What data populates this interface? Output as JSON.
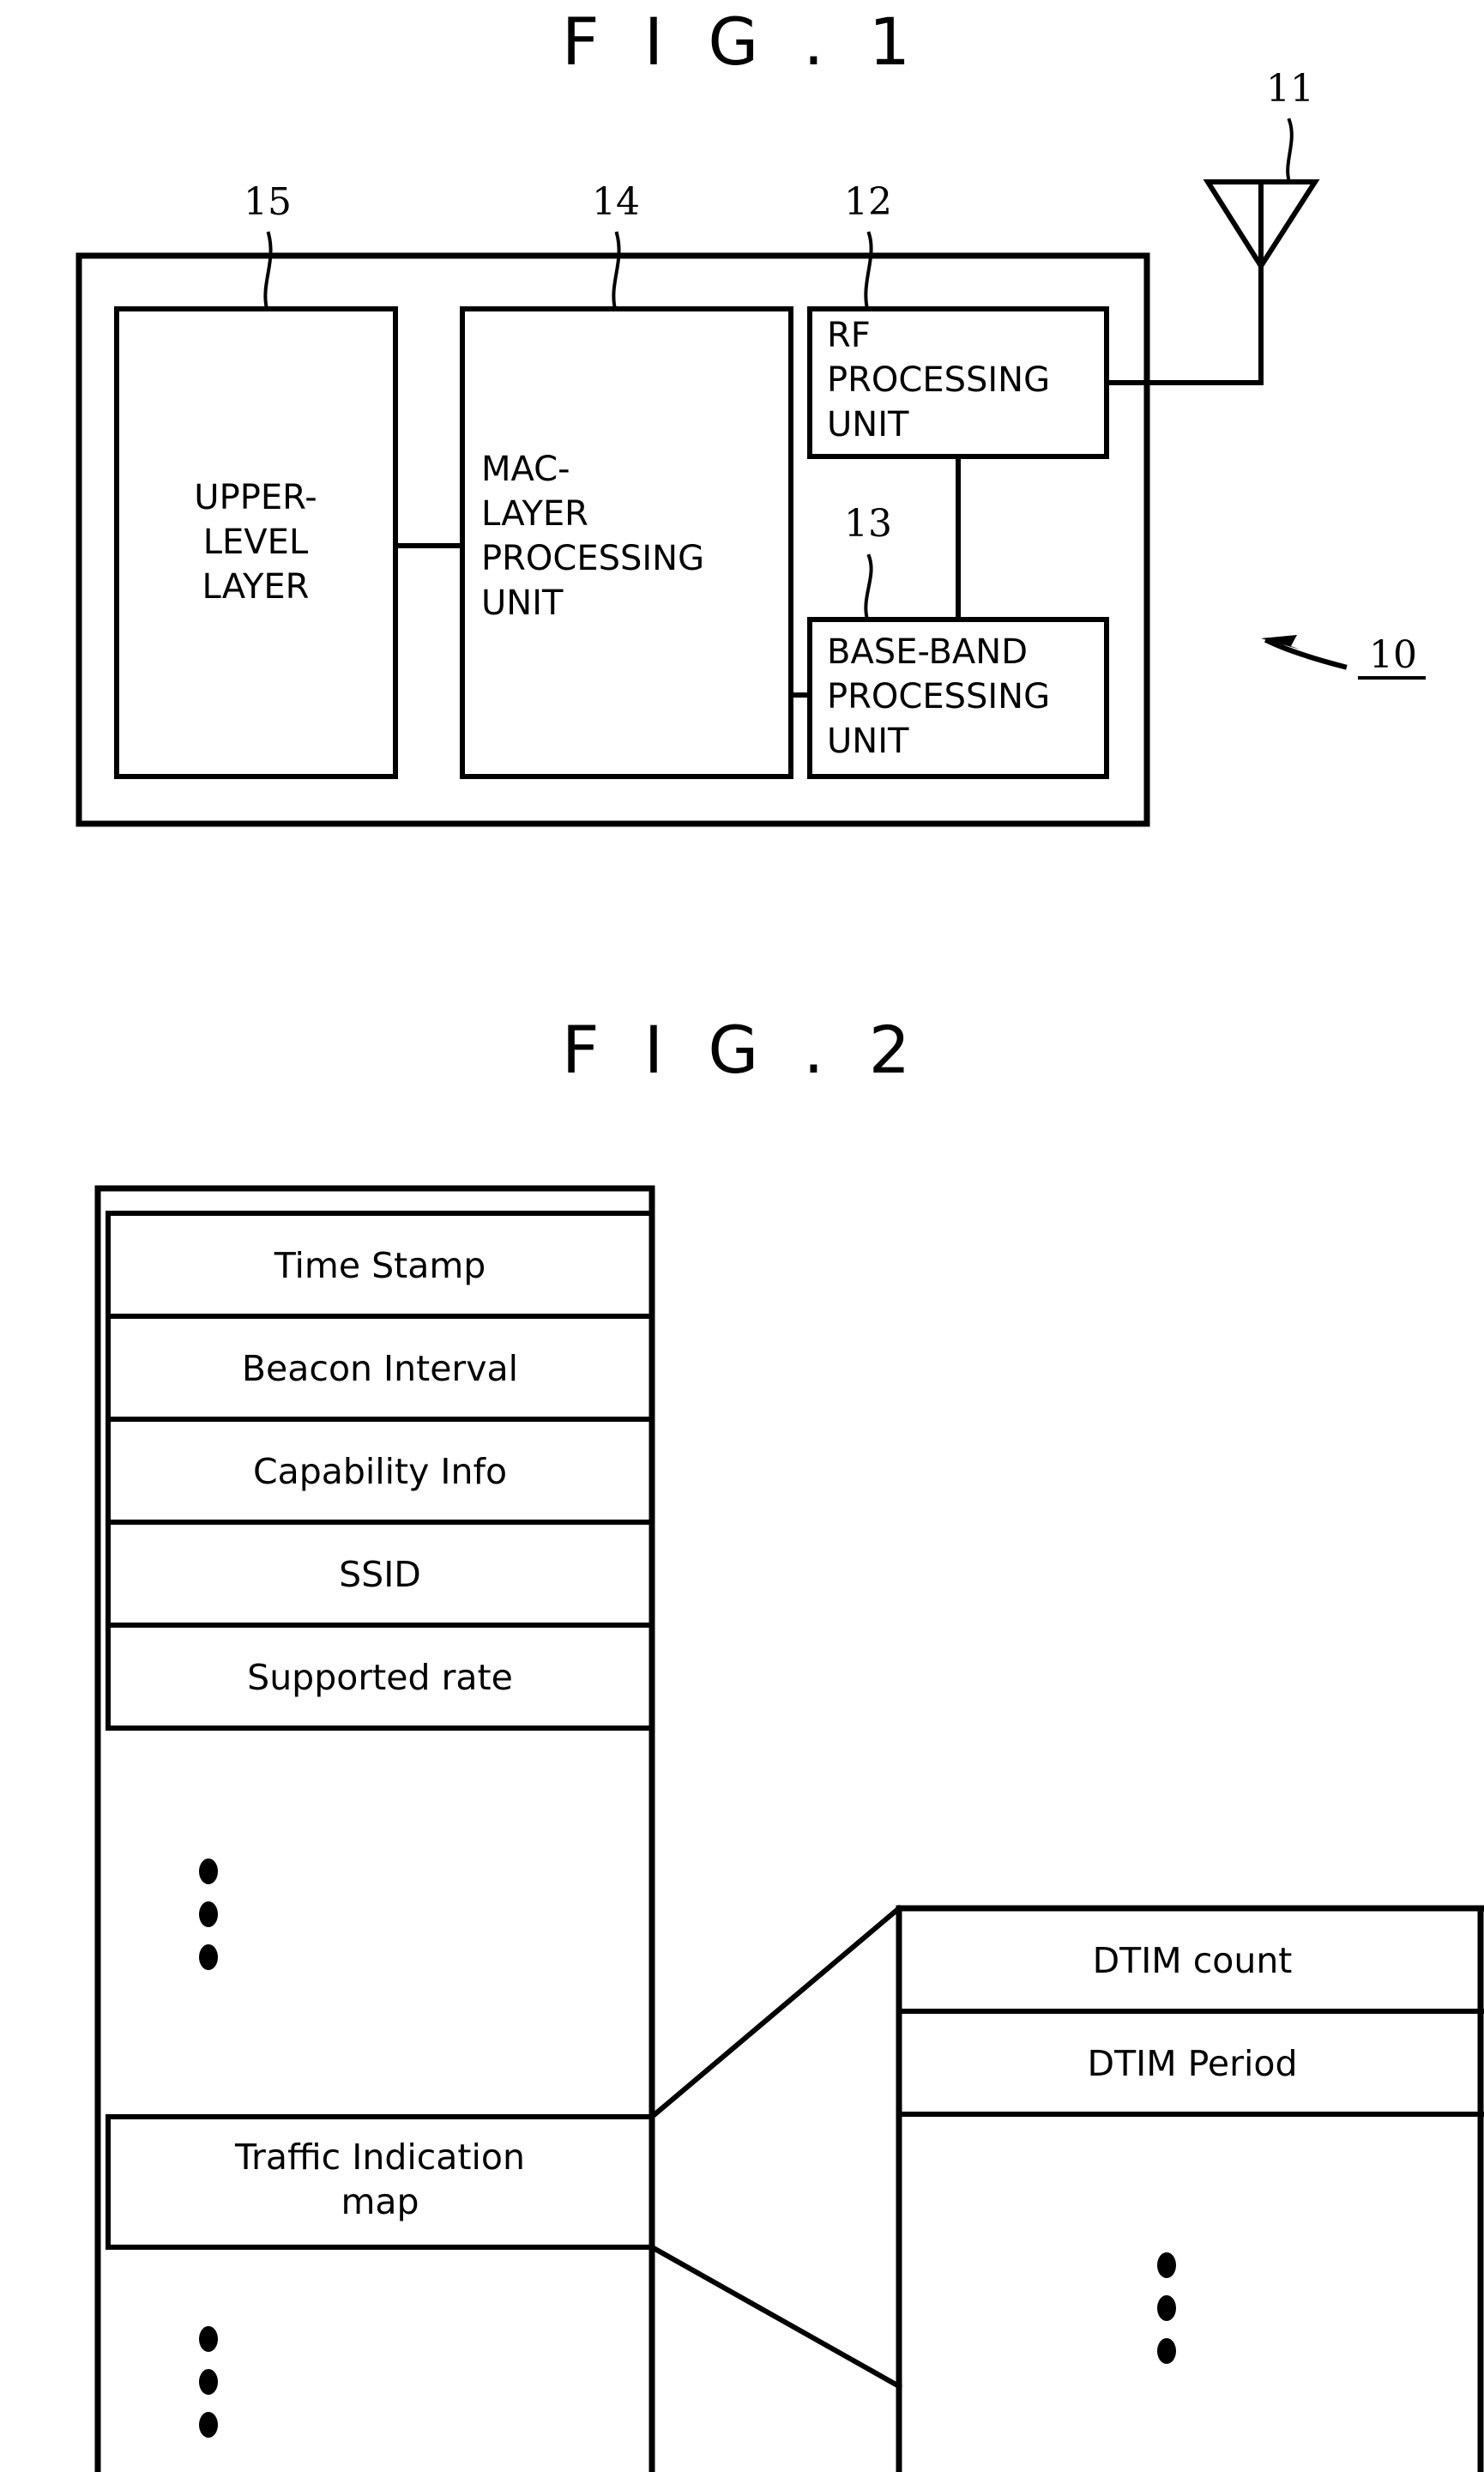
{
  "figure1": {
    "title": "F I G . 1",
    "device_ref": "10",
    "antenna_ref": "11",
    "blocks": [
      {
        "ref": "15",
        "lines": [
          "UPPER-",
          "LEVEL",
          "LAYER"
        ],
        "align": "center"
      },
      {
        "ref": "14",
        "lines": [
          "MAC-",
          "LAYER",
          "PROCESSING",
          "UNIT"
        ],
        "align": "left"
      },
      {
        "ref": "12",
        "lines": [
          "RF",
          "PROCESSING",
          "UNIT"
        ],
        "align": "left"
      },
      {
        "ref": "13",
        "lines": [
          "BASE-BAND",
          "PROCESSING",
          "UNIT"
        ],
        "align": "left"
      }
    ]
  },
  "figure2": {
    "title": "F I G . 2",
    "frame_rows": [
      {
        "label": "Time Stamp"
      },
      {
        "label": "Beacon Interval"
      },
      {
        "label": "Capability Info"
      },
      {
        "label": "SSID"
      },
      {
        "label": "Supported rate"
      },
      {
        "label": "",
        "ellipsis": true
      },
      {
        "label": "Traffic Indication map"
      },
      {
        "label": "",
        "ellipsis": true
      }
    ],
    "detail_rows": [
      {
        "label": "DTIM count"
      },
      {
        "label": "DTIM Period"
      },
      {
        "label": "",
        "ellipsis": true
      }
    ]
  },
  "colors": {
    "ink": "#000000",
    "paper": "#ffffff"
  }
}
